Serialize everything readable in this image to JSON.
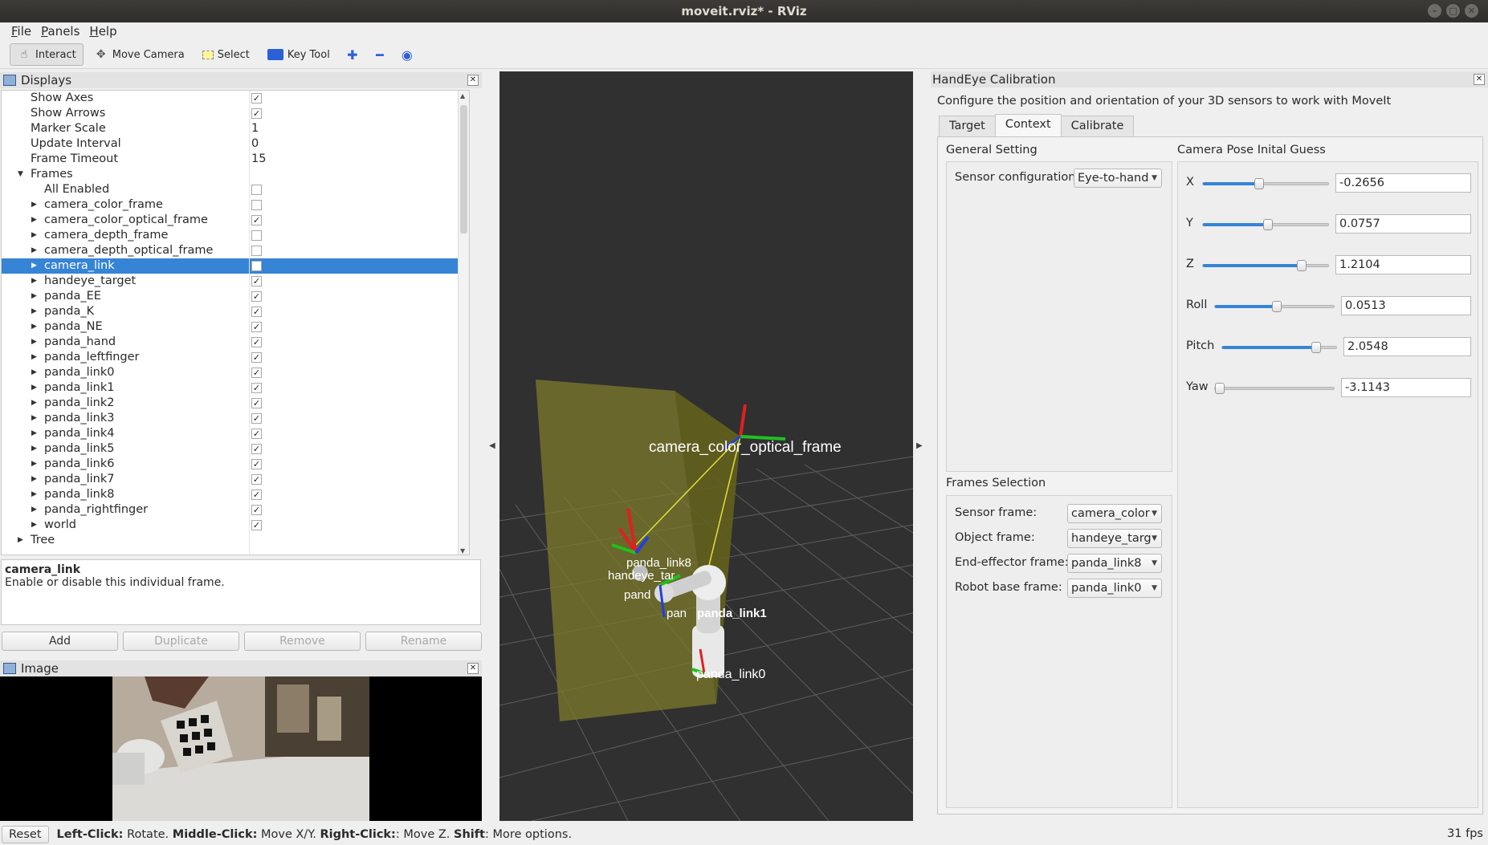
{
  "window": {
    "title": "moveit.rviz* - RViz"
  },
  "menu": [
    {
      "label": "File",
      "mnemonic": "F",
      "rest": "ile"
    },
    {
      "label": "Panels",
      "mnemonic": "P",
      "rest": "anels"
    },
    {
      "label": "Help",
      "mnemonic": "H",
      "rest": "elp"
    }
  ],
  "toolbar": {
    "interact": "Interact",
    "move_camera": "Move Camera",
    "select": "Select",
    "key_tool": "Key Tool"
  },
  "displays": {
    "title": "Displays",
    "rows": [
      {
        "label": "Show Axes",
        "type": "check",
        "checked": true,
        "indent": 36
      },
      {
        "label": "Show Arrows",
        "type": "check",
        "checked": true,
        "indent": 36
      },
      {
        "label": "Marker Scale",
        "type": "value",
        "value": "1",
        "indent": 36
      },
      {
        "label": "Update Interval",
        "type": "value",
        "value": "0",
        "indent": 36
      },
      {
        "label": "Frame Timeout",
        "type": "value",
        "value": "15",
        "indent": 36
      },
      {
        "label": "Frames",
        "type": "none",
        "arrow": "down",
        "indent": 36
      },
      {
        "label": "All Enabled",
        "type": "check",
        "checked": false,
        "indent": 53
      },
      {
        "label": "camera_color_frame",
        "type": "check",
        "checked": false,
        "arrow": "right",
        "indent": 53
      },
      {
        "label": "camera_color_optical_frame",
        "type": "check",
        "checked": true,
        "arrow": "right",
        "indent": 53
      },
      {
        "label": "camera_depth_frame",
        "type": "check",
        "checked": false,
        "arrow": "right",
        "indent": 53
      },
      {
        "label": "camera_depth_optical_frame",
        "type": "check",
        "checked": false,
        "arrow": "right",
        "indent": 53
      },
      {
        "label": "camera_link",
        "type": "check",
        "checked": false,
        "arrow": "right",
        "indent": 53,
        "selected": true
      },
      {
        "label": "handeye_target",
        "type": "check",
        "checked": true,
        "arrow": "right",
        "indent": 53
      },
      {
        "label": "panda_EE",
        "type": "check",
        "checked": true,
        "arrow": "right",
        "indent": 53
      },
      {
        "label": "panda_K",
        "type": "check",
        "checked": true,
        "arrow": "right",
        "indent": 53
      },
      {
        "label": "panda_NE",
        "type": "check",
        "checked": true,
        "arrow": "right",
        "indent": 53
      },
      {
        "label": "panda_hand",
        "type": "check",
        "checked": true,
        "arrow": "right",
        "indent": 53
      },
      {
        "label": "panda_leftfinger",
        "type": "check",
        "checked": true,
        "arrow": "right",
        "indent": 53
      },
      {
        "label": "panda_link0",
        "type": "check",
        "checked": true,
        "arrow": "right",
        "indent": 53
      },
      {
        "label": "panda_link1",
        "type": "check",
        "checked": true,
        "arrow": "right",
        "indent": 53
      },
      {
        "label": "panda_link2",
        "type": "check",
        "checked": true,
        "arrow": "right",
        "indent": 53
      },
      {
        "label": "panda_link3",
        "type": "check",
        "checked": true,
        "arrow": "right",
        "indent": 53
      },
      {
        "label": "panda_link4",
        "type": "check",
        "checked": true,
        "arrow": "right",
        "indent": 53
      },
      {
        "label": "panda_link5",
        "type": "check",
        "checked": true,
        "arrow": "right",
        "indent": 53
      },
      {
        "label": "panda_link6",
        "type": "check",
        "checked": true,
        "arrow": "right",
        "indent": 53
      },
      {
        "label": "panda_link7",
        "type": "check",
        "checked": true,
        "arrow": "right",
        "indent": 53
      },
      {
        "label": "panda_link8",
        "type": "check",
        "checked": true,
        "arrow": "right",
        "indent": 53
      },
      {
        "label": "panda_rightfinger",
        "type": "check",
        "checked": true,
        "arrow": "right",
        "indent": 53
      },
      {
        "label": "world",
        "type": "check",
        "checked": true,
        "arrow": "right",
        "indent": 53
      },
      {
        "label": "Tree",
        "type": "none",
        "arrow": "right",
        "indent": 36
      }
    ],
    "description_title": "camera_link",
    "description_text": "Enable or disable this individual frame.",
    "buttons": {
      "add": "Add",
      "duplicate": "Duplicate",
      "remove": "Remove",
      "rename": "Rename"
    }
  },
  "image_panel": {
    "title": "Image"
  },
  "view3d": {
    "labels": {
      "camera_frame": "camera_color_optical_frame",
      "target": "handeye_tar",
      "link8": "panda_link8",
      "link2": "pan",
      "link1": "panda_link1",
      "link0": "panda_link0",
      "ee": "pand"
    }
  },
  "handeye": {
    "title": "HandEye Calibration",
    "subtitle": "Configure the position and orientation of your 3D sensors to work with MoveIt",
    "tabs": [
      "Target",
      "Context",
      "Calibrate"
    ],
    "active_tab": "Context",
    "general_setting": {
      "title": "General Setting",
      "sensor_config_label": "Sensor configuration",
      "sensor_config_value": "Eye-to-hand"
    },
    "frames_selection": {
      "title": "Frames Selection",
      "fields": [
        {
          "label": "Sensor frame:",
          "value": "camera_color"
        },
        {
          "label": "Object frame:",
          "value": "handeye_targ"
        },
        {
          "label": "End-effector frame:",
          "value": "panda_link8"
        },
        {
          "label": "Robot base frame:",
          "value": "panda_link0"
        }
      ]
    },
    "camera_pose": {
      "title": "Camera Pose Inital Guess",
      "fields": [
        {
          "label": "X",
          "value": "-0.2656",
          "fraction": 0.44
        },
        {
          "label": "Y",
          "value": "0.0757",
          "fraction": 0.51
        },
        {
          "label": "Z",
          "value": "1.2104",
          "fraction": 0.78
        },
        {
          "label": "Roll",
          "value": "0.0513",
          "fraction": 0.51
        },
        {
          "label": "Pitch",
          "value": "2.0548",
          "fraction": 0.81
        },
        {
          "label": "Yaw",
          "value": "-3.1143",
          "fraction": 0.0
        }
      ]
    }
  },
  "statusbar": {
    "reset": "Reset",
    "hint_parts": [
      {
        "bold": "Left-Click:",
        "text": " Rotate. "
      },
      {
        "bold": "Middle-Click:",
        "text": " Move X/Y. "
      },
      {
        "bold": "Right-Click:",
        "text": ": Move Z. "
      },
      {
        "bold": "Shift",
        "text": ": More options."
      }
    ],
    "fps": "31 fps"
  },
  "colors": {
    "selection": "#3584d6",
    "view_bg": "#303030",
    "frustum": "#7c7a2a"
  }
}
